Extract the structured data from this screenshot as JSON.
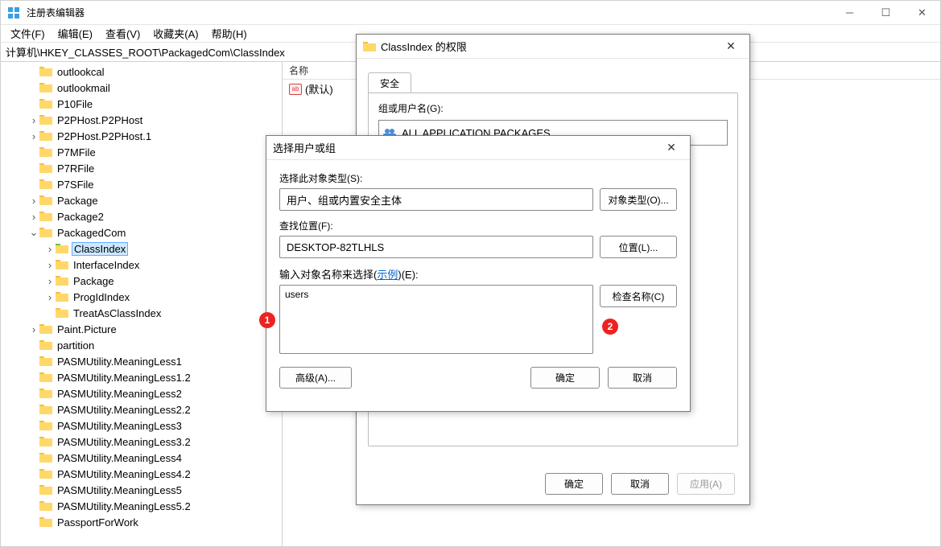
{
  "window": {
    "title": "注册表编辑器"
  },
  "menu": {
    "file": "文件(F)",
    "edit": "编辑(E)",
    "view": "查看(V)",
    "favorites": "收藏夹(A)",
    "help": "帮助(H)"
  },
  "path": "计算机\\HKEY_CLASSES_ROOT\\PackagedCom\\ClassIndex",
  "tree": [
    {
      "label": "outlookcal",
      "exp": "",
      "indent": 1
    },
    {
      "label": "outlookmail",
      "exp": "",
      "indent": 1
    },
    {
      "label": "P10File",
      "exp": "",
      "indent": 1
    },
    {
      "label": "P2PHost.P2PHost",
      "exp": ">",
      "indent": 1
    },
    {
      "label": "P2PHost.P2PHost.1",
      "exp": ">",
      "indent": 1
    },
    {
      "label": "P7MFile",
      "exp": "",
      "indent": 1
    },
    {
      "label": "P7RFile",
      "exp": "",
      "indent": 1
    },
    {
      "label": "P7SFile",
      "exp": "",
      "indent": 1
    },
    {
      "label": "Package",
      "exp": ">",
      "indent": 1
    },
    {
      "label": "Package2",
      "exp": ">",
      "indent": 1
    },
    {
      "label": "PackagedCom",
      "exp": "v",
      "indent": 1
    },
    {
      "label": "ClassIndex",
      "exp": ">",
      "indent": 2,
      "selected": true
    },
    {
      "label": "InterfaceIndex",
      "exp": ">",
      "indent": 2
    },
    {
      "label": "Package",
      "exp": ">",
      "indent": 2
    },
    {
      "label": "ProgIdIndex",
      "exp": ">",
      "indent": 2
    },
    {
      "label": "TreatAsClassIndex",
      "exp": "",
      "indent": 2
    },
    {
      "label": "Paint.Picture",
      "exp": ">",
      "indent": 1
    },
    {
      "label": "partition",
      "exp": "",
      "indent": 1
    },
    {
      "label": "PASMUtility.MeaningLess1",
      "exp": "",
      "indent": 1
    },
    {
      "label": "PASMUtility.MeaningLess1.2",
      "exp": "",
      "indent": 1
    },
    {
      "label": "PASMUtility.MeaningLess2",
      "exp": "",
      "indent": 1
    },
    {
      "label": "PASMUtility.MeaningLess2.2",
      "exp": "",
      "indent": 1
    },
    {
      "label": "PASMUtility.MeaningLess3",
      "exp": "",
      "indent": 1
    },
    {
      "label": "PASMUtility.MeaningLess3.2",
      "exp": "",
      "indent": 1
    },
    {
      "label": "PASMUtility.MeaningLess4",
      "exp": "",
      "indent": 1
    },
    {
      "label": "PASMUtility.MeaningLess4.2",
      "exp": "",
      "indent": 1
    },
    {
      "label": "PASMUtility.MeaningLess5",
      "exp": "",
      "indent": 1
    },
    {
      "label": "PASMUtility.MeaningLess5.2",
      "exp": "",
      "indent": 1
    },
    {
      "label": "PassportForWork",
      "exp": "",
      "indent": 1
    }
  ],
  "list": {
    "header_name": "名称",
    "default_row": "(默认)",
    "str_icon": "ab"
  },
  "perm_dialog": {
    "title": "ClassIndex 的权限",
    "tab": "安全",
    "group_label": "组或用户名(G):",
    "acct": "ALL APPLICATION PACKAGES",
    "btn_ok": "确定",
    "btn_cancel": "取消",
    "btn_apply": "应用(A)"
  },
  "sel_dialog": {
    "title": "选择用户或组",
    "obj_type_lbl": "选择此对象类型(S):",
    "obj_type_val": "用户、组或内置安全主体",
    "obj_type_btn": "对象类型(O)...",
    "loc_lbl": "查找位置(F):",
    "loc_val": "DESKTOP-82TLHLS",
    "loc_btn": "位置(L)...",
    "names_lbl_1": "输入对象名称来选择(",
    "names_link": "示例",
    "names_lbl_2": ")(E):",
    "names_val": "users",
    "check_btn": "检查名称(C)",
    "adv_btn": "高级(A)...",
    "ok": "确定",
    "cancel": "取消"
  },
  "badges": {
    "one": "1",
    "two": "2"
  }
}
